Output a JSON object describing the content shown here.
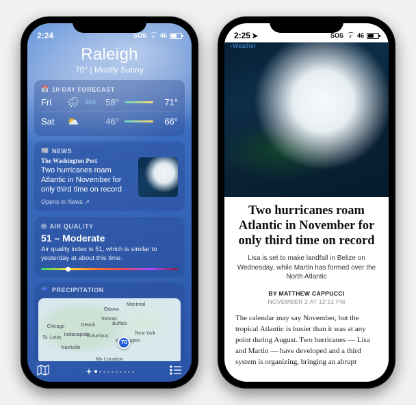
{
  "left": {
    "status": {
      "time": "2:24",
      "indicator": "SOS",
      "battery": "46"
    },
    "city": "Raleigh",
    "temp": "70°",
    "sep": "  |  ",
    "condition": "Mostly Sunny",
    "forecast": {
      "heading": "10-DAY FORECAST",
      "rows": [
        {
          "day": "Fri",
          "icon": "🌧",
          "pop": "50%",
          "lo": "58°",
          "hi": "71°"
        },
        {
          "day": "Sat",
          "icon": "⛅",
          "pop": "",
          "lo": "46°",
          "hi": "66°"
        }
      ]
    },
    "news": {
      "heading": "NEWS",
      "source": "The Washington Post",
      "headline": "Two hurricanes roam Atlantic in November for only third time on record",
      "open": "Opens in News ↗"
    },
    "aq": {
      "heading": "AIR QUALITY",
      "value": "51 – Moderate",
      "desc": "Air quality index is 51, which is similar to yesterday at about this time."
    },
    "precip": {
      "heading": "PRECIPITATION",
      "pin_temp": "70",
      "my_location": "My Location",
      "cities": {
        "montreal": "Montreal",
        "ottawa": "Ottawa",
        "toronto": "Toronto",
        "chicago": "Chicago",
        "detroit": "Detroit",
        "buffalo": "Buffalo",
        "columbus": "Columbus",
        "ny": "New York",
        "indianapolis": "Indianapolis",
        "stlouis": "St. Louis",
        "nashville": "Nashville",
        "washington": "Washington"
      }
    }
  },
  "right": {
    "status": {
      "time": "2:25",
      "indicator": "SOS",
      "battery": "46"
    },
    "back": "Weather",
    "title": "Two hurricanes roam Atlantic in November for only third time on record",
    "deck": "Lisa is set to make landfall in Belize on Wednesday, while Martin has formed over the North Atlantic",
    "byline_prefix": "BY ",
    "byline": "MATTHEW CAPPUCCI",
    "date": "NOVEMBER 2 AT 12:51 PM",
    "body": "The calendar may say November, but the tropical Atlantic is busier than it was at any point during August. Two hurricanes — Lisa and Martin — have developed and a third system is organizing, bringing an abrupt"
  }
}
